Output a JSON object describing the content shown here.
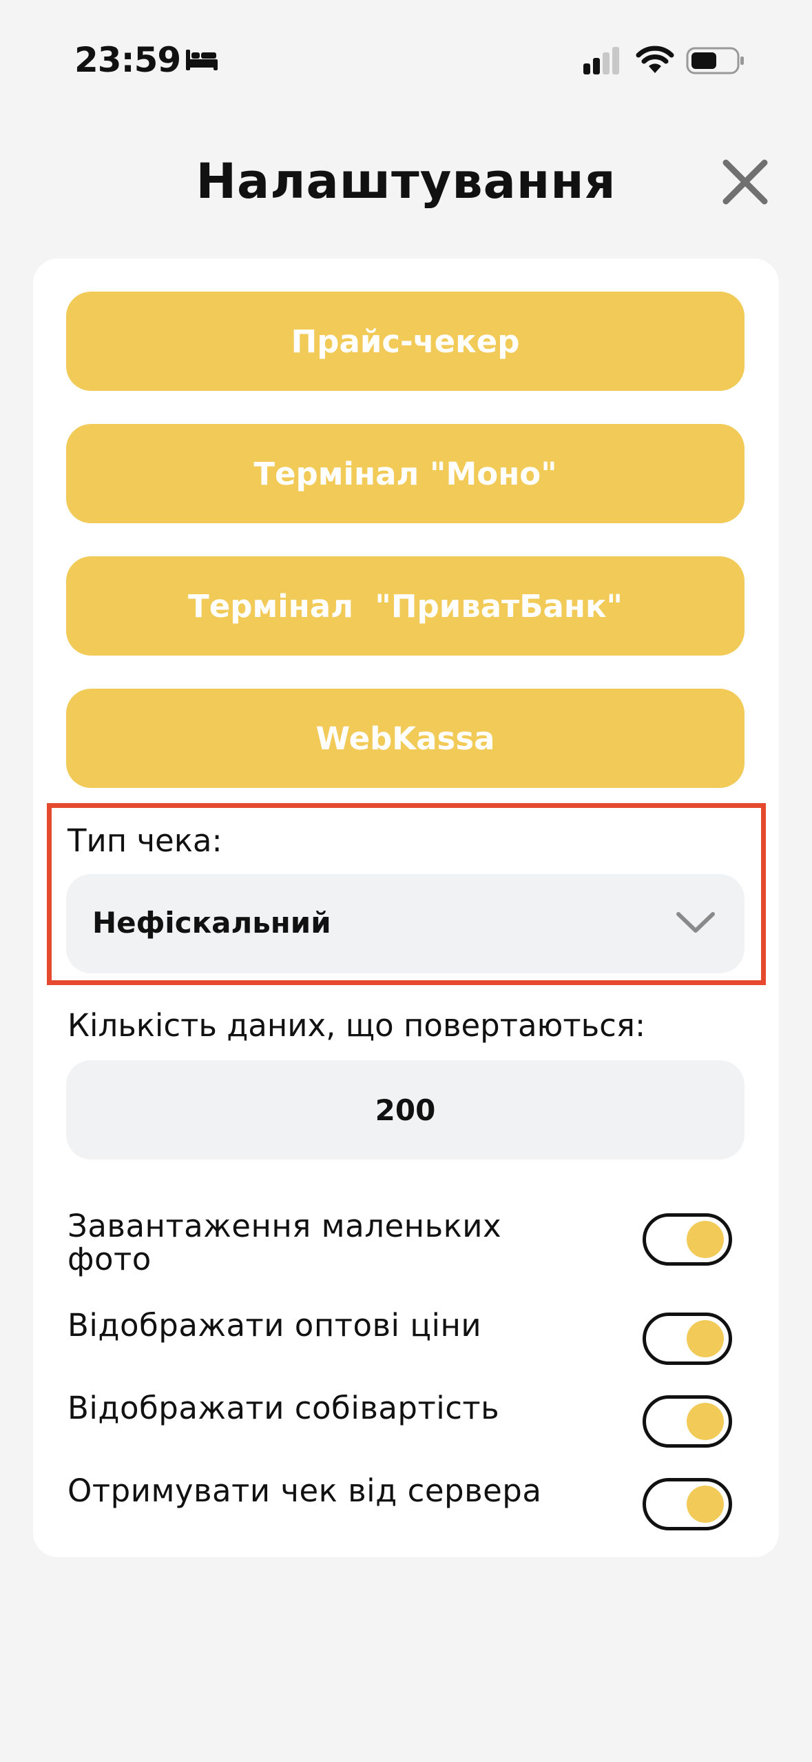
{
  "status_bar": {
    "time": "23:59",
    "icons": [
      "bed-icon",
      "cellular-signal-icon",
      "wifi-icon",
      "battery-icon"
    ]
  },
  "header": {
    "title": "Налаштування",
    "close_icon": "close-icon"
  },
  "buttons": {
    "price_checker": "Прайс-чекер",
    "terminal_mono": "Термінал \"Моно\"",
    "terminal_privatbank": "Термінал  \"ПриватБанк\"",
    "webkassa": "WebKassa"
  },
  "receipt_type": {
    "label": "Тип чека:",
    "selected": "Нефіскальний"
  },
  "returned_count": {
    "label": "Кількість даних, що повертаються:",
    "value": "200"
  },
  "toggles": [
    {
      "label": "Завантаження маленьких фото",
      "on": true
    },
    {
      "label": "Відображати оптові ціни",
      "on": true
    },
    {
      "label": "Відображати собівартість",
      "on": true
    },
    {
      "label": "Отримувати чек від сервера",
      "on": true
    }
  ],
  "colors": {
    "accent": "#f2ca57",
    "highlight": "#e64a2e",
    "background": "#f4f4f4",
    "field": "#f1f2f4"
  }
}
